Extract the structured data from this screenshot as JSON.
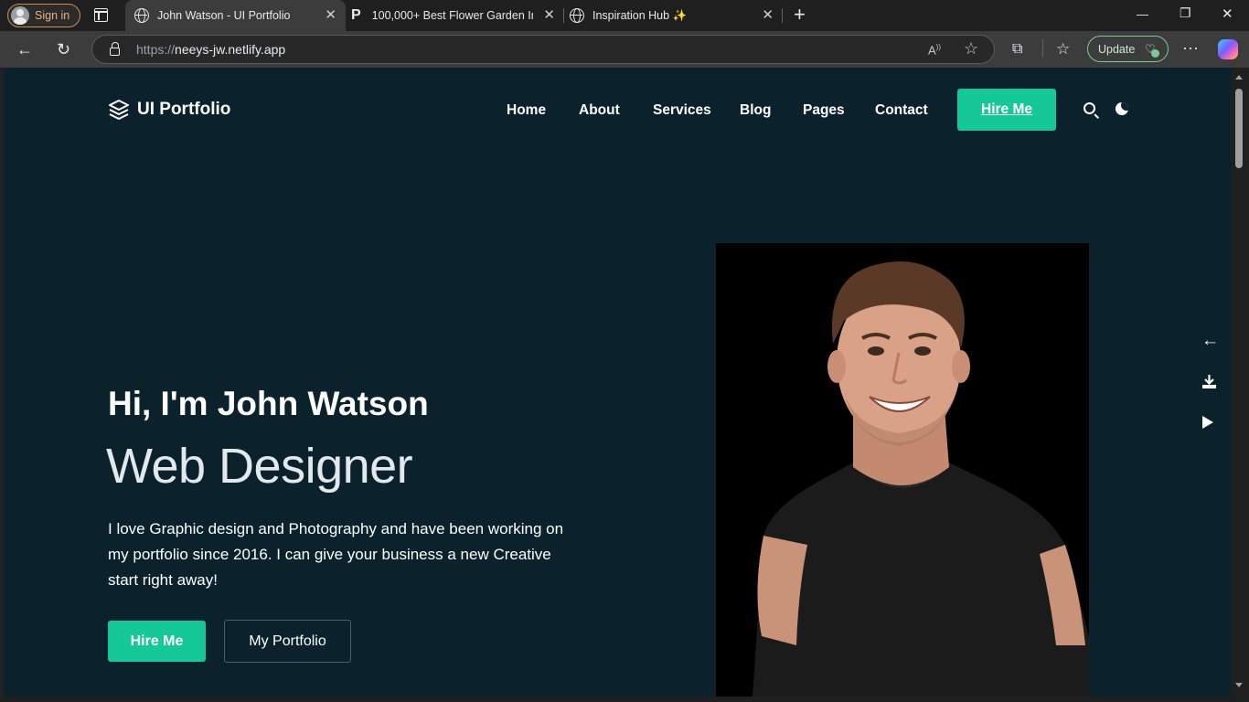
{
  "browser": {
    "sign_in": "Sign in",
    "tabs": [
      {
        "title": "John Watson - UI Portfolio",
        "close": "✕",
        "active": true
      },
      {
        "title": "100,000+ Best Flower Garden Ima",
        "close": "✕",
        "active": false
      },
      {
        "title": "Inspiration Hub ✨",
        "close": "✕",
        "active": false
      }
    ],
    "new_tab": "+",
    "window_controls": {
      "minimize": "—",
      "restore": "❐",
      "close": "✕"
    },
    "url_prefix": "https://",
    "url_host": "neeys-jw.netlify.app",
    "update_label": "Update"
  },
  "site": {
    "logo_text": "UI Portfolio",
    "nav": [
      "Home",
      "About",
      "Services",
      "Blog",
      "Pages",
      "Contact"
    ],
    "hire_nav": "Hire Me"
  },
  "hero": {
    "greeting": "Hi, I'm John Watson",
    "role": "Web Designer",
    "bio": "I love Graphic design and Photography and have been working on my portfolio since 2016. I can give your business a new Creative start right away!",
    "primary_cta": "Hire Me",
    "secondary_cta": "My Portfolio"
  },
  "colors": {
    "page_bg": "#0b222d",
    "accent": "#14c897",
    "text": "#ffffff"
  },
  "icons": {
    "side": [
      "arrow-left-icon",
      "download-icon",
      "play-icon"
    ]
  }
}
